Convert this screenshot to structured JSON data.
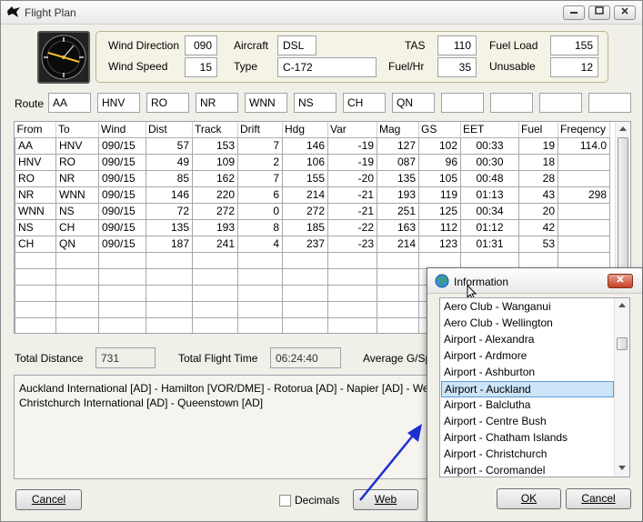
{
  "window": {
    "title": "Flight Plan"
  },
  "params": {
    "wind_direction_label": "Wind Direction",
    "wind_direction": "090",
    "wind_speed_label": "Wind Speed",
    "wind_speed": "15",
    "aircraft_label": "Aircraft",
    "aircraft": "DSL",
    "type_label": "Type",
    "type": "C-172",
    "tas_label": "TAS",
    "tas": "110",
    "fuel_hr_label": "Fuel/Hr",
    "fuel_hr": "35",
    "fuel_load_label": "Fuel Load",
    "fuel_load": "155",
    "unusable_label": "Unusable",
    "unusable": "12"
  },
  "route": {
    "label": "Route",
    "points": [
      "AA",
      "HNV",
      "RO",
      "NR",
      "WNN",
      "NS",
      "CH",
      "QN",
      "",
      "",
      "",
      ""
    ]
  },
  "grid": {
    "columns": [
      "From",
      "To",
      "Wind",
      "Dist",
      "Track",
      "Drift",
      "Hdg",
      "Var",
      "Mag",
      "GS",
      "EET",
      "Fuel",
      "Freqency"
    ],
    "rows": [
      [
        "AA",
        "HNV",
        "090/15",
        "57",
        "153",
        "7",
        "146",
        "-19",
        "127",
        "102",
        "00:33",
        "19",
        "114.0"
      ],
      [
        "HNV",
        "RO",
        "090/15",
        "49",
        "109",
        "2",
        "106",
        "-19",
        "087",
        "96",
        "00:30",
        "18",
        ""
      ],
      [
        "RO",
        "NR",
        "090/15",
        "85",
        "162",
        "7",
        "155",
        "-20",
        "135",
        "105",
        "00:48",
        "28",
        ""
      ],
      [
        "NR",
        "WNN",
        "090/15",
        "146",
        "220",
        "6",
        "214",
        "-21",
        "193",
        "119",
        "01:13",
        "43",
        "298"
      ],
      [
        "WNN",
        "NS",
        "090/15",
        "72",
        "272",
        "0",
        "272",
        "-21",
        "251",
        "125",
        "00:34",
        "20",
        ""
      ],
      [
        "NS",
        "CH",
        "090/15",
        "135",
        "193",
        "8",
        "185",
        "-22",
        "163",
        "112",
        "01:12",
        "42",
        ""
      ],
      [
        "CH",
        "QN",
        "090/15",
        "187",
        "241",
        "4",
        "237",
        "-23",
        "214",
        "123",
        "01:31",
        "53",
        ""
      ],
      [
        "",
        "",
        "",
        "",
        "",
        "",
        "",
        "",
        "",
        "",
        "",
        "",
        ""
      ],
      [
        "",
        "",
        "",
        "",
        "",
        "",
        "",
        "",
        "",
        "",
        "",
        "",
        ""
      ],
      [
        "",
        "",
        "",
        "",
        "",
        "",
        "",
        "",
        "",
        "",
        "",
        "",
        ""
      ],
      [
        "",
        "",
        "",
        "",
        "",
        "",
        "",
        "",
        "",
        "",
        "",
        "",
        ""
      ],
      [
        "",
        "",
        "",
        "",
        "",
        "",
        "",
        "",
        "",
        "",
        "",
        "",
        ""
      ]
    ]
  },
  "summary": {
    "total_distance_label": "Total Distance",
    "total_distance": "731",
    "total_flight_time_label": "Total Flight Time",
    "total_flight_time": "06:24:40",
    "average_gs_label": "Average G/Sp"
  },
  "route_text": {
    "line1": "Auckland International [AD] - Hamilton [VOR/DME] - Rotorua [AD] - Napier [AD] - We",
    "line2": "Christchurch International [AD] - Queenstown [AD]"
  },
  "buttons": {
    "cancel": "Cancel",
    "decimals": "Decimals",
    "web": "Web"
  },
  "info_dialog": {
    "title": "Information",
    "items": [
      "Aero Club - Wanganui",
      "Aero Club - Wellington",
      "Airport - Alexandra",
      "Airport - Ardmore",
      "Airport - Ashburton",
      "Airport - Auckland",
      "Airport - Balclutha",
      "Airport - Centre Bush",
      "Airport - Chatham Islands",
      "Airport - Christchurch",
      "Airport - Coromandel"
    ],
    "selected_index": 5,
    "ok": "OK",
    "cancel": "Cancel"
  },
  "colors": {
    "selection": "#cce4f7",
    "arrow": "#1f2fd0",
    "panel_border": "#b8b48f"
  }
}
